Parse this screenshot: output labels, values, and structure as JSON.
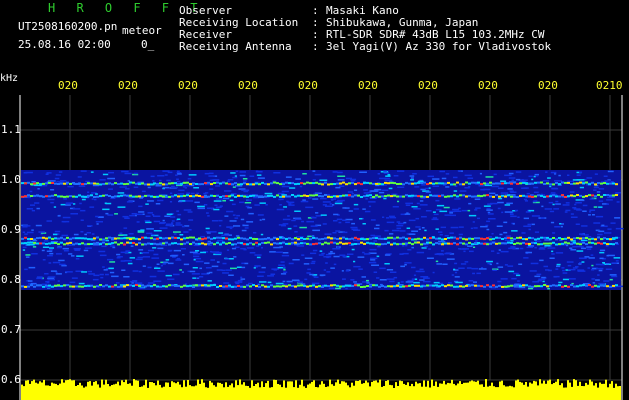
{
  "header": {
    "title": "H R O F F T",
    "filename": "UT2508160200.pn",
    "kind": "meteor",
    "datetime": "25.08.16 02:00",
    "status": "0_",
    "info": [
      {
        "label": "Observer",
        "value": "Masaki Kano"
      },
      {
        "label": "Receiving Location",
        "value": "Shibukawa, Gunma, Japan"
      },
      {
        "label": "Receiver",
        "value": "RTL-SDR SDR# 43dB L15 103.2MHz CW"
      },
      {
        "label": "Receiving Antenna",
        "value": "3el Yagi(V) Az 330 for Vladivostok"
      }
    ],
    "separator": ":"
  },
  "axes": {
    "y_unit": "kHz",
    "y_ticks": [
      "1.1",
      "1.0",
      "0.9",
      "0.8",
      "0.7",
      "0.6"
    ],
    "x_ticks": [
      "020",
      "020",
      "020",
      "020",
      "020",
      "020",
      "020",
      "020",
      "020",
      "0210"
    ]
  },
  "colors": {
    "background": "#000000",
    "title": "#2ecc2e",
    "x_tick_labels": "#ffff30",
    "amplitude_trace": "#ffff00",
    "grid": "#3a3a3a",
    "spectrogram_base": "#0a14a0"
  },
  "chart_data": {
    "type": "heatmap",
    "x_ticks": [
      "020",
      "020",
      "020",
      "020",
      "020",
      "020",
      "020",
      "020",
      "020",
      "0210"
    ],
    "y_unit": "kHz",
    "ylim": [
      0.6,
      1.15
    ],
    "signal_band_khz": [
      0.78,
      1.02
    ],
    "bright_lines_khz": [
      0.995,
      0.97,
      0.885,
      0.875,
      0.79
    ]
  }
}
